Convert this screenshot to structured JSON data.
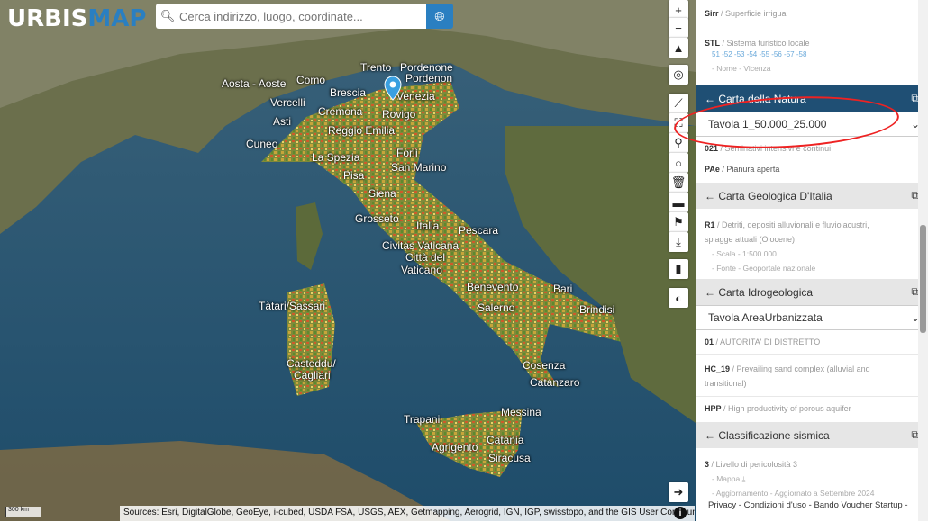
{
  "logo": {
    "part1": "URBIS",
    "part2": "MAP"
  },
  "search": {
    "placeholder": "Cerca indirizzo, luogo, coordinate..."
  },
  "map": {
    "cities": [
      {
        "name": "Trento"
      },
      {
        "name": "Pordenone"
      },
      {
        "name": "Pordenon"
      },
      {
        "name": "Aosta - Aoste"
      },
      {
        "name": "Como"
      },
      {
        "name": "Vercelli"
      },
      {
        "name": "Brescia"
      },
      {
        "name": "Venezia"
      },
      {
        "name": "Asti"
      },
      {
        "name": "Cremona"
      },
      {
        "name": "Rovigo"
      },
      {
        "name": "Reggio Emilia"
      },
      {
        "name": "Cuneo"
      },
      {
        "name": "La Spezia"
      },
      {
        "name": "Forlì"
      },
      {
        "name": "San Marino"
      },
      {
        "name": "Pisa"
      },
      {
        "name": "Siena"
      },
      {
        "name": "Grosseto"
      },
      {
        "name": "Italia"
      },
      {
        "name": "Pescara"
      },
      {
        "name": "Civitas Vaticana"
      },
      {
        "name": "Città del"
      },
      {
        "name": "Vaticano"
      },
      {
        "name": "Benevento"
      },
      {
        "name": "Bari"
      },
      {
        "name": "Salerno"
      },
      {
        "name": "Brindisi"
      },
      {
        "name": "Tàtari/Sassari"
      },
      {
        "name": "Casteddu/"
      },
      {
        "name": "Cagliari"
      },
      {
        "name": "Cosenza"
      },
      {
        "name": "Catanzaro"
      },
      {
        "name": "Messina"
      },
      {
        "name": "Trapani"
      },
      {
        "name": "Catania"
      },
      {
        "name": "Agrigento"
      },
      {
        "name": "Siracusa"
      }
    ],
    "scale_label": "300 km",
    "sources": "Sources: Esri, DigitalGlobe, GeoEye, i-cubed, USDA FSA, USGS, AEX, Getmapping, Aerogrid, IGN, IGP, swisstopo, and the GIS User Community"
  },
  "panel": {
    "sirr": {
      "code": "Sirr",
      "desc": " / Superficie irrigua"
    },
    "stl": {
      "code": "STL",
      "desc": " / Sistema turistico locale",
      "sub": "51 -52 -53 -54 -55 -56 -57 -58",
      "name": "- Nome - Vicenza"
    },
    "natura": {
      "title": "← Carta della Natura",
      "select": "Tavola 1_50.000_25.000",
      "item1_code": "021",
      "item1_desc": " / Seminativi intensivi e continui",
      "item2_code": "PAe",
      "item2_desc": " / Pianura aperta"
    },
    "geologica": {
      "title": "← Carta Geologica D'Italia",
      "code": "R1",
      "desc": " / Detriti, depositi alluvionali e fluviolacustri,",
      "desc2": "spiagge attuali (Olocene)",
      "scala": "- Scala - 1:500.000",
      "fonte": "- Fonte - Geoportale nazionale"
    },
    "idro": {
      "title": "← Carta Idrogeologica",
      "select": "Tavola AreaUrbanizzata",
      "i1_code": "01",
      "i1_desc": " / AUTORITA' DI DISTRETTO",
      "i2_code": "HC_19",
      "i2_desc": " / Prevailing sand complex (alluvial and",
      "i2_desc2": "transitional)",
      "i3_code": "HPP",
      "i3_desc": " / High productivity of porous aquifer"
    },
    "sismica": {
      "title": "← Classificazione sismica",
      "code": "3",
      "desc": " / Livello di pericolosità 3",
      "mappa": "- Mappa",
      "agg": "- Aggiornamento - Aggiornato a Settembre 2024"
    },
    "footer": "Privacy - Condizioni d'uso - Bando Voucher Startup -"
  },
  "colors": {
    "accent": "#2a7fc1",
    "panel_header_dark": "#1f4f74",
    "annotation": "#ee2222"
  }
}
